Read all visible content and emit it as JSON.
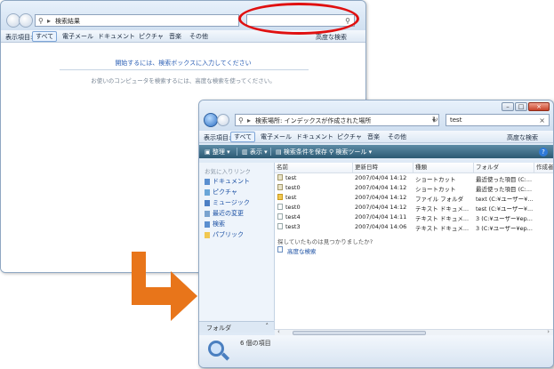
{
  "back_window": {
    "address": "検索結果",
    "filter_label": "表示項目:",
    "filters": [
      "すべて",
      "電子メール",
      "ドキュメント",
      "ピクチャ",
      "音楽",
      "その他"
    ],
    "advanced_search": "高度な検索",
    "hint_primary": "開始するには、検索ボックスに入力してください",
    "hint_secondary": "お使いのコンピュータを検索するには、高度な検索を使ってください。"
  },
  "front_window": {
    "address": "検索場所: インデックスが作成された場所",
    "search_value": "test",
    "filter_label": "表示項目:",
    "filters": [
      "すべて",
      "電子メール",
      "ドキュメント",
      "ピクチャ",
      "音楽",
      "その他"
    ],
    "advanced_search": "高度な検索",
    "commands": [
      "整理",
      "表示",
      "検索条件を保存",
      "検索ツール"
    ],
    "favorites_header": "お気に入りリンク",
    "nav_items": [
      "ドキュメント",
      "ピクチャ",
      "ミュージック",
      "最近の変更",
      "検索",
      "パブリック"
    ],
    "folder_label": "フォルダ",
    "columns": [
      "名前",
      "更新日時",
      "種類",
      "フォルダ",
      "作成者"
    ],
    "rows": [
      {
        "icon": "shortcut",
        "name": "test",
        "date": "2007/04/04 14:12",
        "type": "ショートカット",
        "folder": "最近使った項目 (C:..."
      },
      {
        "icon": "shortcut",
        "name": "test0",
        "date": "2007/04/04 14:12",
        "type": "ショートカット",
        "folder": "最近使った項目 (C:..."
      },
      {
        "icon": "folder",
        "name": "test",
        "date": "2007/04/04 14:12",
        "type": "ファイル フォルダ",
        "folder": "text (C:¥ユーザー¥..."
      },
      {
        "icon": "text",
        "name": "test0",
        "date": "2007/04/04 14:12",
        "type": "テキスト ドキュメ...",
        "folder": "test (C:¥ユーザー¥..."
      },
      {
        "icon": "text",
        "name": "test4",
        "date": "2007/04/04 14:11",
        "type": "テキスト ドキュメ...",
        "folder": "3 (C:¥ユーザー¥ep..."
      },
      {
        "icon": "text",
        "name": "test3",
        "date": "2007/04/04 14:06",
        "type": "テキスト ドキュメ...",
        "folder": "3 (C:¥ユーザー¥ep..."
      }
    ],
    "not_found": "探していたものは見つかりましたか?",
    "advanced_search_link": "高度な検索",
    "item_count": "6 個の項目"
  },
  "colors": {
    "annotation_ellipse": "#e01010",
    "arrow": "#e8751a",
    "link_blue": "#2b5fb5"
  }
}
